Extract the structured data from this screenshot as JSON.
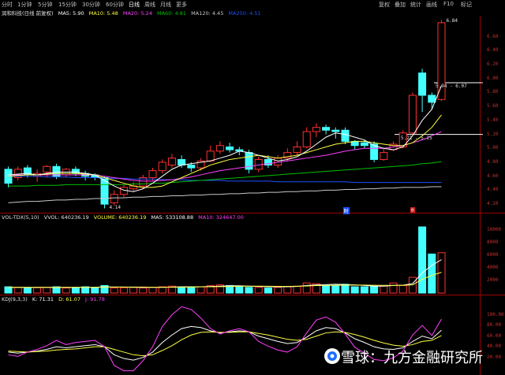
{
  "tabs": [
    "分时",
    "1分钟",
    "5分钟",
    "15分钟",
    "30分钟",
    "60分钟",
    "日线",
    "周线",
    "月线",
    "更多"
  ],
  "active_tab": "日线",
  "right_tabs": [
    "复权",
    "叠加",
    "统计",
    "画线",
    "F10",
    "标记"
  ],
  "main_info": {
    "stock": "润和科技(日线 前复权)",
    "ma5": "MA5: 5.90",
    "ma10": "MA10: 5.48",
    "ma20": "MA20: 5.24",
    "ma60": "MA60: 4.81",
    "ma120": "MA120: 4.45",
    "ma250": "MA250: 4.51"
  },
  "vol_info": {
    "label": "VOL-TDX(5,10)",
    "vvol": "VVOL: 640236.19",
    "volume": "VOLUME: 640236.19",
    "ma5": "MA5: 533108.88",
    "ma10": "MA10: 324647.00"
  },
  "kdj_info": {
    "label": "KDJ(9,3,3)",
    "k": "K: 71.31",
    "d": "D: 61.07",
    "j": "J: 91.78"
  },
  "price_axis": [
    "6.60",
    "6.40",
    "6.20",
    "6.00",
    "5.80",
    "5.60",
    "5.40",
    "5.20",
    "5.00",
    "4.80",
    "4.60",
    "4.40",
    "4.20"
  ],
  "vol_axis": [
    "10000",
    "8000",
    "6000",
    "4000",
    "2000"
  ],
  "kdj_axis": [
    "100.00",
    "80.00",
    "60.00",
    "40.00",
    "20.00"
  ],
  "annotations": {
    "high": "6.84",
    "low": "4.14",
    "range_upper": "5.94 - 6.07",
    "range_lower": "5.21 - 5.25"
  },
  "markers": [
    "财",
    "◎"
  ],
  "watermark": "雪球：九方金融研究所",
  "colors": {
    "up": "#ff3030",
    "down": "#44ffff",
    "ma5": "#ffffff",
    "ma10": "#ffff40",
    "ma20": "#ff40ff",
    "ma60": "#00c000",
    "ma120": "#c8c8c8",
    "ma250": "#2050ff",
    "axis": "#9a0000"
  },
  "chart_data": {
    "type": "candlestick",
    "ylim": [
      4.1,
      6.9
    ],
    "candles": [
      {
        "o": 4.7,
        "c": 4.5,
        "h": 4.74,
        "l": 4.44
      },
      {
        "o": 4.58,
        "c": 4.7,
        "h": 4.74,
        "l": 4.54
      },
      {
        "o": 4.72,
        "c": 4.62,
        "h": 4.76,
        "l": 4.58
      },
      {
        "o": 4.6,
        "c": 4.64,
        "h": 4.7,
        "l": 4.52
      },
      {
        "o": 4.66,
        "c": 4.74,
        "h": 4.76,
        "l": 4.58
      },
      {
        "o": 4.74,
        "c": 4.6,
        "h": 4.78,
        "l": 4.56
      },
      {
        "o": 4.62,
        "c": 4.7,
        "h": 4.72,
        "l": 4.58
      },
      {
        "o": 4.7,
        "c": 4.64,
        "h": 4.74,
        "l": 4.6
      },
      {
        "o": 4.64,
        "c": 4.6,
        "h": 4.68,
        "l": 4.54
      },
      {
        "o": 4.62,
        "c": 4.58,
        "h": 4.64,
        "l": 4.54
      },
      {
        "o": 4.58,
        "c": 4.2,
        "h": 4.6,
        "l": 4.14
      },
      {
        "o": 4.22,
        "c": 4.34,
        "h": 4.4,
        "l": 4.18
      },
      {
        "o": 4.34,
        "c": 4.44,
        "h": 4.48,
        "l": 4.3
      },
      {
        "o": 4.42,
        "c": 4.46,
        "h": 4.52,
        "l": 4.38
      },
      {
        "o": 4.46,
        "c": 4.58,
        "h": 4.62,
        "l": 4.42
      },
      {
        "o": 4.58,
        "c": 4.68,
        "h": 4.72,
        "l": 4.54
      },
      {
        "o": 4.68,
        "c": 4.8,
        "h": 4.84,
        "l": 4.64
      },
      {
        "o": 4.76,
        "c": 4.86,
        "h": 4.92,
        "l": 4.72
      },
      {
        "o": 4.84,
        "c": 4.76,
        "h": 4.9,
        "l": 4.72
      },
      {
        "o": 4.76,
        "c": 4.72,
        "h": 4.8,
        "l": 4.66
      },
      {
        "o": 4.72,
        "c": 4.82,
        "h": 4.86,
        "l": 4.68
      },
      {
        "o": 4.82,
        "c": 4.96,
        "h": 5.04,
        "l": 4.8
      },
      {
        "o": 4.96,
        "c": 5.04,
        "h": 5.1,
        "l": 4.92
      },
      {
        "o": 5.02,
        "c": 4.98,
        "h": 5.08,
        "l": 4.94
      },
      {
        "o": 4.98,
        "c": 4.96,
        "h": 5.02,
        "l": 4.9
      },
      {
        "o": 4.94,
        "c": 4.7,
        "h": 4.98,
        "l": 4.64
      },
      {
        "o": 4.7,
        "c": 4.84,
        "h": 4.88,
        "l": 4.66
      },
      {
        "o": 4.84,
        "c": 4.76,
        "h": 4.9,
        "l": 4.72
      },
      {
        "o": 4.76,
        "c": 4.86,
        "h": 4.9,
        "l": 4.72
      },
      {
        "o": 4.86,
        "c": 4.94,
        "h": 5.0,
        "l": 4.82
      },
      {
        "o": 4.94,
        "c": 5.02,
        "h": 5.1,
        "l": 4.9
      },
      {
        "o": 5.02,
        "c": 5.24,
        "h": 5.3,
        "l": 5.0
      },
      {
        "o": 5.24,
        "c": 5.3,
        "h": 5.36,
        "l": 5.16
      },
      {
        "o": 5.3,
        "c": 5.26,
        "h": 5.34,
        "l": 5.2
      },
      {
        "o": 5.26,
        "c": 5.24,
        "h": 5.3,
        "l": 5.14
      },
      {
        "o": 5.26,
        "c": 5.1,
        "h": 5.3,
        "l": 5.06
      },
      {
        "o": 5.1,
        "c": 5.04,
        "h": 5.12,
        "l": 4.98
      },
      {
        "o": 5.08,
        "c": 5.04,
        "h": 5.12,
        "l": 5.0
      },
      {
        "o": 5.06,
        "c": 4.84,
        "h": 5.1,
        "l": 4.8
      },
      {
        "o": 4.84,
        "c": 4.94,
        "h": 5.0,
        "l": 4.82
      },
      {
        "o": 4.98,
        "c": 5.06,
        "h": 5.1,
        "l": 4.96
      },
      {
        "o": 5.02,
        "c": 5.22,
        "h": 5.26,
        "l": 5.0
      },
      {
        "o": 5.22,
        "c": 5.76,
        "h": 5.8,
        "l": 5.2
      },
      {
        "o": 6.08,
        "c": 5.76,
        "h": 6.14,
        "l": 5.52
      },
      {
        "o": 5.76,
        "c": 5.66,
        "h": 5.8,
        "l": 5.56
      },
      {
        "o": 5.7,
        "c": 6.8,
        "h": 6.84,
        "l": 5.68
      }
    ],
    "volume": [
      1.0,
      0.9,
      0.8,
      0.85,
      0.9,
      1.0,
      0.8,
      0.9,
      1.0,
      0.9,
      1.2,
      0.8,
      0.85,
      0.9,
      0.8,
      0.9,
      1.0,
      1.1,
      0.9,
      1.0,
      1.0,
      1.2,
      1.3,
      1.2,
      1.0,
      0.9,
      0.9,
      0.8,
      0.9,
      1.0,
      1.1,
      1.6,
      1.5,
      1.2,
      1.2,
      1.4,
      1.0,
      1.0,
      1.1,
      1.2,
      1.6,
      1.2,
      2.5,
      10.5,
      6.2,
      6.4
    ],
    "ma5_line": [
      4.62,
      4.63,
      4.64,
      4.62,
      4.64,
      4.66,
      4.66,
      4.66,
      4.64,
      4.62,
      4.54,
      4.46,
      4.4,
      4.38,
      4.42,
      4.5,
      4.6,
      4.7,
      4.76,
      4.78,
      4.8,
      4.82,
      4.86,
      4.9,
      4.96,
      4.94,
      4.9,
      4.86,
      4.82,
      4.84,
      4.88,
      4.96,
      5.06,
      5.16,
      5.22,
      5.2,
      5.16,
      5.12,
      5.04,
      5.0,
      4.98,
      5.02,
      5.18,
      5.4,
      5.56,
      5.9
    ],
    "ma10_line": [
      4.6,
      4.61,
      4.62,
      4.62,
      4.63,
      4.64,
      4.64,
      4.64,
      4.63,
      4.62,
      4.58,
      4.54,
      4.5,
      4.46,
      4.44,
      4.44,
      4.46,
      4.52,
      4.58,
      4.64,
      4.7,
      4.76,
      4.8,
      4.84,
      4.86,
      4.88,
      4.9,
      4.88,
      4.86,
      4.88,
      4.9,
      4.94,
      4.98,
      5.02,
      5.06,
      5.08,
      5.1,
      5.1,
      5.08,
      5.06,
      5.04,
      5.04,
      5.08,
      5.18,
      5.3,
      5.48
    ],
    "ma20_line": [
      4.62,
      4.62,
      4.62,
      4.62,
      4.62,
      4.62,
      4.62,
      4.62,
      4.62,
      4.62,
      4.6,
      4.58,
      4.56,
      4.54,
      4.53,
      4.53,
      4.54,
      4.55,
      4.57,
      4.59,
      4.62,
      4.65,
      4.68,
      4.7,
      4.72,
      4.74,
      4.76,
      4.78,
      4.8,
      4.82,
      4.84,
      4.86,
      4.88,
      4.9,
      4.93,
      4.96,
      4.98,
      5.0,
      5.0,
      5.0,
      5.02,
      5.04,
      5.08,
      5.12,
      5.18,
      5.24
    ],
    "ma60_line": [
      4.46,
      4.46,
      4.46,
      4.47,
      4.47,
      4.47,
      4.48,
      4.48,
      4.48,
      4.48,
      4.48,
      4.48,
      4.48,
      4.49,
      4.49,
      4.5,
      4.5,
      4.51,
      4.52,
      4.53,
      4.54,
      4.55,
      4.56,
      4.57,
      4.58,
      4.59,
      4.6,
      4.61,
      4.62,
      4.63,
      4.64,
      4.65,
      4.66,
      4.67,
      4.68,
      4.69,
      4.7,
      4.71,
      4.72,
      4.73,
      4.74,
      4.75,
      4.76,
      4.78,
      4.79,
      4.81
    ],
    "ma120_line": [
      4.22,
      4.23,
      4.24,
      4.24,
      4.25,
      4.26,
      4.26,
      4.27,
      4.27,
      4.28,
      4.28,
      4.29,
      4.29,
      4.3,
      4.3,
      4.31,
      4.31,
      4.32,
      4.32,
      4.33,
      4.33,
      4.34,
      4.34,
      4.35,
      4.35,
      4.36,
      4.36,
      4.37,
      4.37,
      4.38,
      4.38,
      4.39,
      4.39,
      4.4,
      4.4,
      4.41,
      4.41,
      4.42,
      4.42,
      4.43,
      4.43,
      4.44,
      4.44,
      4.44,
      4.45,
      4.45
    ],
    "ma250_line": [
      4.6,
      4.6,
      4.6,
      4.6,
      4.59,
      4.59,
      4.59,
      4.58,
      4.58,
      4.58,
      4.57,
      4.57,
      4.57,
      4.56,
      4.56,
      4.56,
      4.55,
      4.55,
      4.55,
      4.54,
      4.54,
      4.54,
      4.54,
      4.53,
      4.53,
      4.53,
      4.53,
      4.53,
      4.52,
      4.52,
      4.52,
      4.52,
      4.52,
      4.52,
      4.52,
      4.52,
      4.51,
      4.51,
      4.51,
      4.51,
      4.51,
      4.51,
      4.51,
      4.51,
      4.51,
      4.51
    ],
    "vol_ma5": [
      0.9,
      0.9,
      0.9,
      0.9,
      0.9,
      0.9,
      0.9,
      0.9,
      0.9,
      0.9,
      1.0,
      0.95,
      0.95,
      0.9,
      0.9,
      0.9,
      0.9,
      0.95,
      1.0,
      1.0,
      1.0,
      1.05,
      1.1,
      1.15,
      1.15,
      1.1,
      1.05,
      1.0,
      1.0,
      1.0,
      1.05,
      1.2,
      1.3,
      1.35,
      1.4,
      1.35,
      1.3,
      1.2,
      1.1,
      1.1,
      1.2,
      1.25,
      1.5,
      3.2,
      4.4,
      5.3
    ],
    "vol_ma10": [
      0.9,
      0.9,
      0.9,
      0.9,
      0.9,
      0.9,
      0.9,
      0.9,
      0.9,
      0.9,
      0.95,
      0.95,
      0.95,
      0.95,
      0.95,
      0.92,
      0.92,
      0.92,
      0.94,
      0.96,
      0.98,
      1.0,
      1.02,
      1.05,
      1.08,
      1.1,
      1.1,
      1.08,
      1.06,
      1.06,
      1.08,
      1.12,
      1.18,
      1.22,
      1.24,
      1.26,
      1.26,
      1.26,
      1.24,
      1.22,
      1.22,
      1.24,
      1.3,
      2.2,
      2.8,
      3.3
    ],
    "kdj_k": [
      30,
      28,
      30,
      32,
      35,
      40,
      38,
      40,
      42,
      44,
      40,
      25,
      18,
      15,
      20,
      30,
      48,
      62,
      74,
      78,
      76,
      70,
      66,
      68,
      70,
      68,
      60,
      55,
      50,
      46,
      48,
      58,
      70,
      76,
      74,
      66,
      55,
      48,
      40,
      36,
      35,
      38,
      50,
      60,
      55,
      71
    ],
    "kdj_d": [
      32,
      31,
      30,
      31,
      32,
      34,
      35,
      36,
      38,
      40,
      40,
      35,
      30,
      25,
      23,
      25,
      33,
      42,
      53,
      62,
      67,
      68,
      67,
      67,
      68,
      68,
      65,
      62,
      58,
      54,
      52,
      54,
      60,
      66,
      68,
      67,
      63,
      58,
      52,
      47,
      43,
      41,
      44,
      50,
      52,
      61
    ],
    "kdj_j": [
      25,
      22,
      30,
      35,
      42,
      52,
      44,
      48,
      50,
      52,
      40,
      5,
      -5,
      -5,
      14,
      40,
      78,
      100,
      115,
      110,
      94,
      74,
      64,
      70,
      74,
      68,
      50,
      41,
      34,
      30,
      40,
      66,
      90,
      96,
      86,
      64,
      39,
      28,
      16,
      14,
      19,
      32,
      62,
      80,
      61,
      92
    ]
  }
}
